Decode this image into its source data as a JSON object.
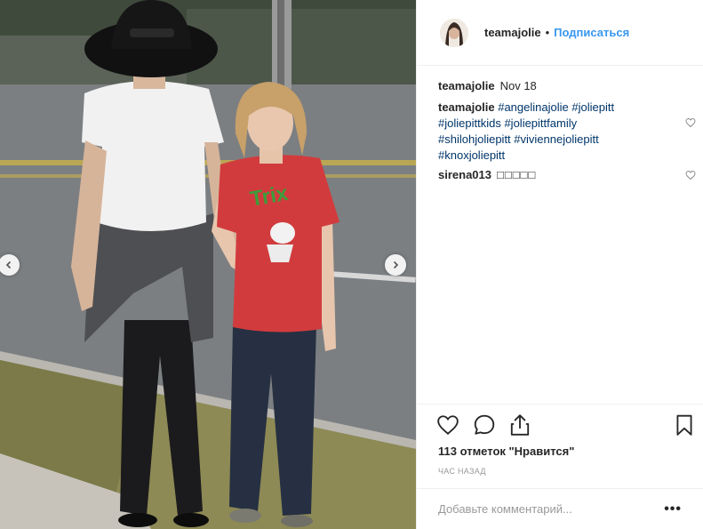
{
  "post": {
    "author": "teamajolie",
    "separator": "•",
    "follow_label": "Подписаться",
    "date": "Nov 18",
    "caption_tags": [
      "#angelinajolie",
      "#joliepitt",
      "#joliepittkids",
      "#joliepittfamily",
      "#shilohjoliepitt",
      "#viviennejoliepitt",
      "#knoxjoliepitt"
    ],
    "comments": [
      {
        "user": "sirena013",
        "text": "□□□□□"
      }
    ],
    "likes_text": "113 отметок \"Нравится\"",
    "time_ago": "ЧАС НАЗАД",
    "add_comment_placeholder": "Добавьте комментарий...",
    "more_label": "•••"
  },
  "photo": {
    "shirt_text": "Trix"
  },
  "icons": {
    "like": "heart-icon",
    "comment": "comment-bubble-icon",
    "share": "share-icon",
    "save": "bookmark-icon",
    "prev": "chevron-left-icon",
    "next": "chevron-right-icon"
  },
  "colors": {
    "link": "#3897f0",
    "hashtag": "#003569",
    "muted": "#999999",
    "text": "#262626",
    "divider": "#efefef"
  }
}
